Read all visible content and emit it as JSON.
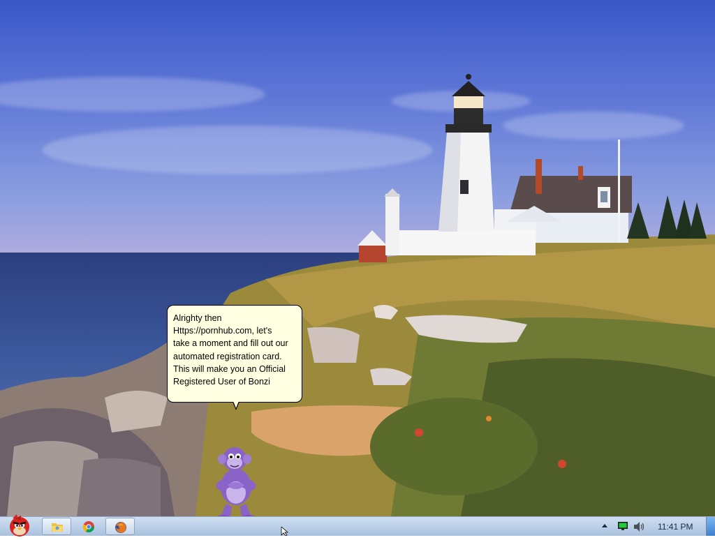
{
  "balloon": {
    "lines": [
      "Alrighty then",
      "Https://pornhub.com, let's",
      "take a moment and fill out our",
      "automated registration card.",
      "This will make you an Official",
      "Registered User of Bonzi"
    ]
  },
  "taskbar": {
    "clock": "11:41 PM",
    "pinned": [
      {
        "name": "explorer",
        "icon": "folder-icon",
        "active": true
      },
      {
        "name": "chrome",
        "icon": "chrome-icon",
        "active": false
      },
      {
        "name": "firefox",
        "icon": "firefox-icon",
        "active": true
      }
    ],
    "start_icon": "angry-bird-icon",
    "tray": [
      "show-hidden-icons-arrow",
      "network-icon",
      "volume-icon"
    ]
  },
  "colors": {
    "balloon_bg": "#ffffe1",
    "taskbar": "#bcd0e8",
    "bonzi_purple": "#8a63c9"
  }
}
